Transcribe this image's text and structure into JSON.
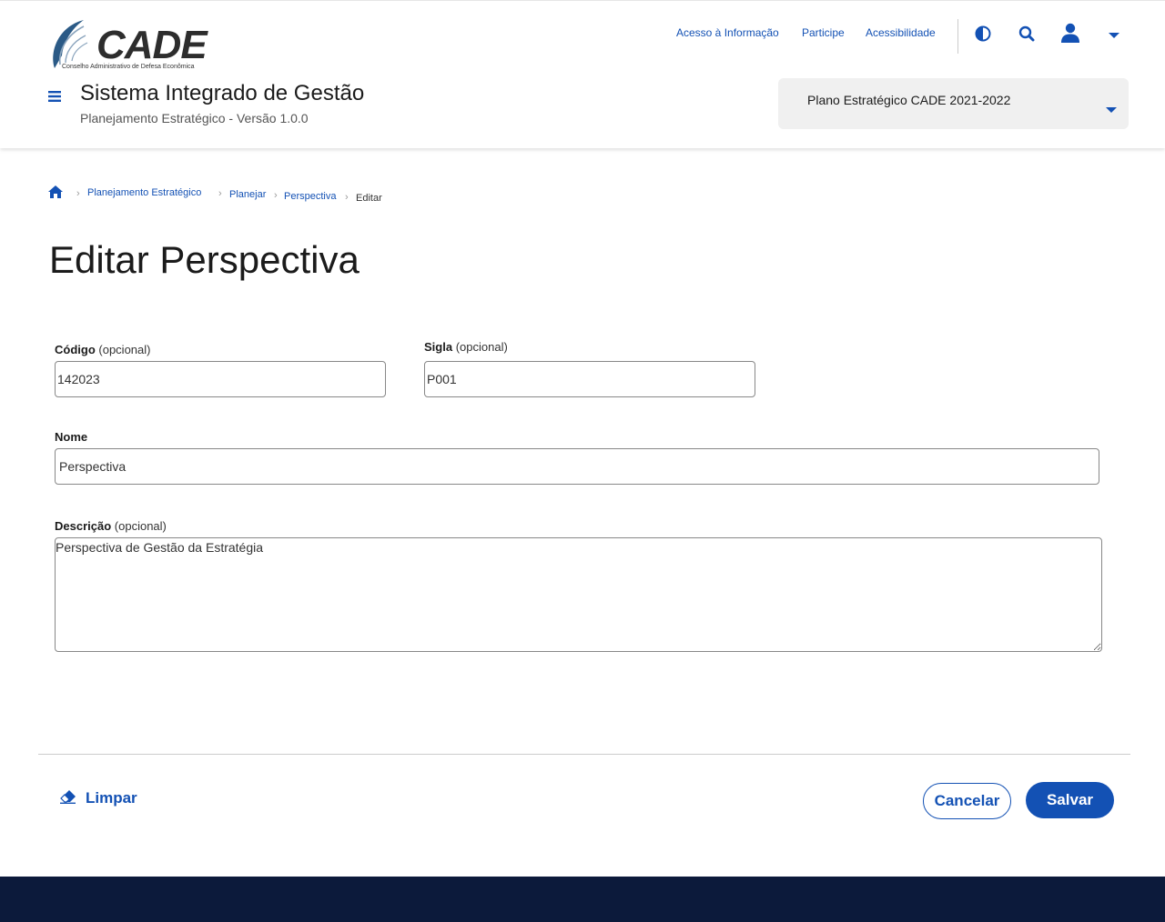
{
  "brand": {
    "logo_text": "CADE",
    "logo_subtitle": "Conselho Administrativo de Defesa Econômica",
    "accent_color": "#1351b4",
    "footer_color": "#0c1a3b"
  },
  "header": {
    "links": [
      "Acesso à Informação",
      "Participe",
      "Acessibilidade"
    ],
    "icons": [
      "contrast-icon",
      "search-icon",
      "user-icon",
      "caret-down-icon"
    ],
    "system_title": "Sistema Integrado de Gestão",
    "system_subtitle": "Planejamento Estratégico - Versão 1.0.0",
    "plan_select": {
      "selected": "Plano Estratégico CADE 2021-2022"
    }
  },
  "breadcrumb": {
    "items": [
      "Planejamento Estratégico",
      "Planejar",
      "Perspectiva"
    ],
    "current": "Editar"
  },
  "page": {
    "title": "Editar Perspectiva"
  },
  "form": {
    "codigo": {
      "label": "Código",
      "optional": "(opcional)",
      "value": "142023"
    },
    "sigla": {
      "label": "Sigla",
      "optional": "(opcional)",
      "value": "P001"
    },
    "nome": {
      "label": "Nome",
      "value": "Perspectiva"
    },
    "descricao": {
      "label": "Descrição",
      "optional": "(opcional)",
      "value": "Perspectiva de Gestão da Estratégia"
    }
  },
  "actions": {
    "clear": "Limpar",
    "cancel": "Cancelar",
    "save": "Salvar"
  }
}
